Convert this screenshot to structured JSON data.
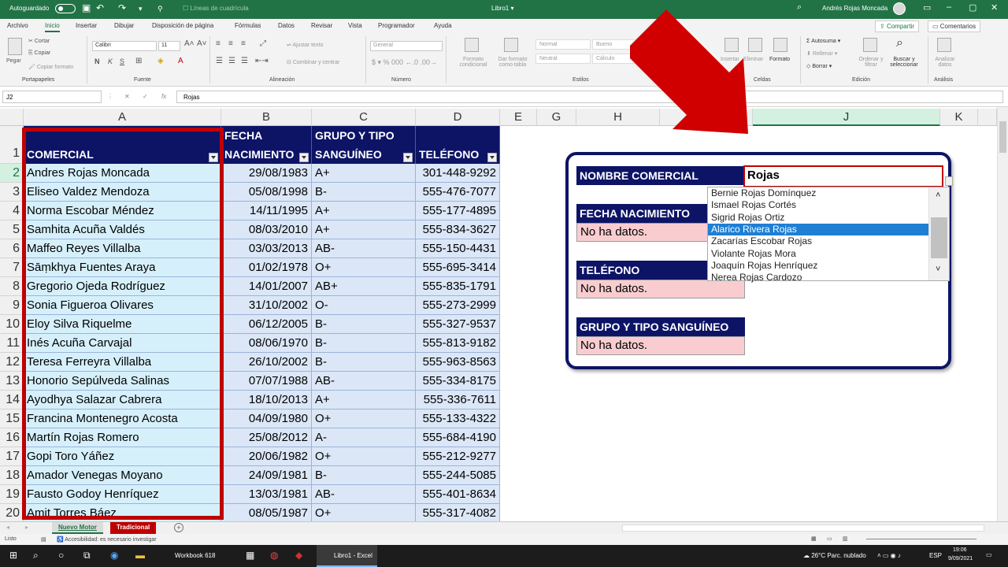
{
  "titlebar": {
    "autosave_label": "Autoguardado",
    "gridlines_label": "Líneas de cuadrícula",
    "document": "Libro1 ▾",
    "user": "Andrés Rojas Moncada"
  },
  "menu": [
    "Archivo",
    "Inicio",
    "Insertar",
    "Dibujar",
    "Disposición de página",
    "Fórmulas",
    "Datos",
    "Revisar",
    "Vista",
    "Programador",
    "Ayuda"
  ],
  "share_label": "Compartir",
  "comments_label": "Comentarios",
  "ribbon": {
    "paste": "Pegar",
    "cut": "Cortar",
    "copy": "Copiar",
    "format_painter": "Copiar formato",
    "font_name": "Calibri",
    "font_size": "11",
    "bold": "N",
    "italic": "K",
    "underline": "S",
    "wrap_text": "Ajustar texto",
    "merge_center": "Combinar y centrar",
    "number_format": "General",
    "conditional_format": "Formato condicional",
    "format_table": "Dar formato como tabla",
    "style_normal": "Normal",
    "style_good": "Bueno",
    "style_neutral": "Neutral",
    "style_calc": "Cálculo",
    "insert": "Insertar",
    "delete": "Eliminar",
    "format": "Formato",
    "autosum": "Autosuma",
    "fill": "Rellenar",
    "clear": "Borrar",
    "sort_filter": "Ordenar y filtrar",
    "find_select": "Buscar y seleccionar",
    "analyze": "Analizar datos",
    "groups": [
      "Portapapeles",
      "Fuente",
      "Alineación",
      "Número",
      "Estilos",
      "Celdas",
      "Edición",
      "Análisis"
    ]
  },
  "formula_bar": {
    "name_box": "J2",
    "fx": "fx",
    "formula": "Rojas"
  },
  "columns": [
    "A",
    "B",
    "C",
    "D",
    "E",
    "G",
    "H",
    "J",
    "K"
  ],
  "table": {
    "headers": {
      "a": "COMERCIAL",
      "b1": "FECHA",
      "b2": "NACIMIENTO",
      "c1": "GRUPO Y TIPO",
      "c2": "SANGUÍNEO",
      "d": "TELÉFONO"
    },
    "rows": [
      {
        "n": "2",
        "name": "Andres Rojas Moncada",
        "date": "29/08/1983",
        "blood": "A+",
        "phone": "301-448-9292"
      },
      {
        "n": "3",
        "name": "Eliseo Valdez Mendoza",
        "date": "05/08/1998",
        "blood": "B-",
        "phone": "555-476-7077"
      },
      {
        "n": "4",
        "name": "Norma Escobar Méndez",
        "date": "14/11/1995",
        "blood": "A+",
        "phone": "555-177-4895"
      },
      {
        "n": "5",
        "name": "Samhita Acuña Valdés",
        "date": "08/03/2010",
        "blood": "A+",
        "phone": "555-834-3627"
      },
      {
        "n": "6",
        "name": "Maffeo Reyes Villalba",
        "date": "03/03/2013",
        "blood": "AB-",
        "phone": "555-150-4431"
      },
      {
        "n": "7",
        "name": "Sāṃkhya Fuentes Araya",
        "date": "01/02/1978",
        "blood": "O+",
        "phone": "555-695-3414"
      },
      {
        "n": "8",
        "name": "Gregorio Ojeda Rodríguez",
        "date": "14/01/2007",
        "blood": "AB+",
        "phone": "555-835-1791"
      },
      {
        "n": "9",
        "name": "Sonia Figueroa Olivares",
        "date": "31/10/2002",
        "blood": "O-",
        "phone": "555-273-2999"
      },
      {
        "n": "10",
        "name": "Eloy Silva Riquelme",
        "date": "06/12/2005",
        "blood": "B-",
        "phone": "555-327-9537"
      },
      {
        "n": "11",
        "name": "Inés Acuña Carvajal",
        "date": "08/06/1970",
        "blood": "B-",
        "phone": "555-813-9182"
      },
      {
        "n": "12",
        "name": "Teresa Ferreyra Villalba",
        "date": "26/10/2002",
        "blood": "B-",
        "phone": "555-963-8563"
      },
      {
        "n": "13",
        "name": "Honorio Sepúlveda Salinas",
        "date": "07/07/1988",
        "blood": "AB-",
        "phone": "555-334-8175"
      },
      {
        "n": "14",
        "name": "Ayodhya Salazar Cabrera",
        "date": "18/10/2013",
        "blood": "A+",
        "phone": "555-336-7611"
      },
      {
        "n": "15",
        "name": "Francina Montenegro Acosta",
        "date": "04/09/1980",
        "blood": "O+",
        "phone": "555-133-4322"
      },
      {
        "n": "16",
        "name": "Martín Rojas Romero",
        "date": "25/08/2012",
        "blood": "A-",
        "phone": "555-684-4190"
      },
      {
        "n": "17",
        "name": "Gopi Toro Yáñez",
        "date": "20/06/1982",
        "blood": "O+",
        "phone": "555-212-9277"
      },
      {
        "n": "18",
        "name": "Amador Venegas Moyano",
        "date": "24/09/1981",
        "blood": "B-",
        "phone": "555-244-5085"
      },
      {
        "n": "19",
        "name": "Fausto Godoy Henríquez",
        "date": "13/03/1981",
        "blood": "AB-",
        "phone": "555-401-8634"
      },
      {
        "n": "20",
        "name": "Amit Torres Báez",
        "date": "08/05/1987",
        "blood": "O+",
        "phone": "555-317-4082"
      }
    ]
  },
  "panel": {
    "name_label": "NOMBRE COMERCIAL",
    "name_value": "Rojas",
    "birth_label": "FECHA NACIMIENTO",
    "birth_value": "No ha datos.",
    "phone_label": "TELÉFONO",
    "phone_value": "No ha datos.",
    "blood_label": "GRUPO Y TIPO SANGUÍNEO",
    "blood_value": "No ha datos.",
    "dropdown": [
      "Bernie Rojas Domínquez",
      "Ismael Rojas Cortés",
      "Sigrid Rojas Ortiz",
      "Alarico Rivera Rojas",
      "Zacarías Escobar Rojas",
      "Violante Rojas Mora",
      "Joaquín Rojas Henríquez",
      "Nerea Rojas Cardozo"
    ],
    "dropdown_highlighted_index": 3
  },
  "sheet_tabs": [
    "Nuevo Motor",
    "Tradicional"
  ],
  "status": {
    "ready": "Listo",
    "accessibility": "Accesibilidad: es necesario investigar"
  },
  "taskbar": {
    "app1": "Workbook 618",
    "app2": "Libro1 - Excel",
    "weather": "26°C  Parc. nublado",
    "lang": "ESP",
    "time": "19:06",
    "date": "9/09/2021"
  },
  "colors": {
    "excel_green": "#217346",
    "navy": "#0d1466",
    "red": "#c00000",
    "light_cyan": "#d6f0fb",
    "light_blue": "#dbe7f7",
    "pink": "#f9cdd0"
  }
}
